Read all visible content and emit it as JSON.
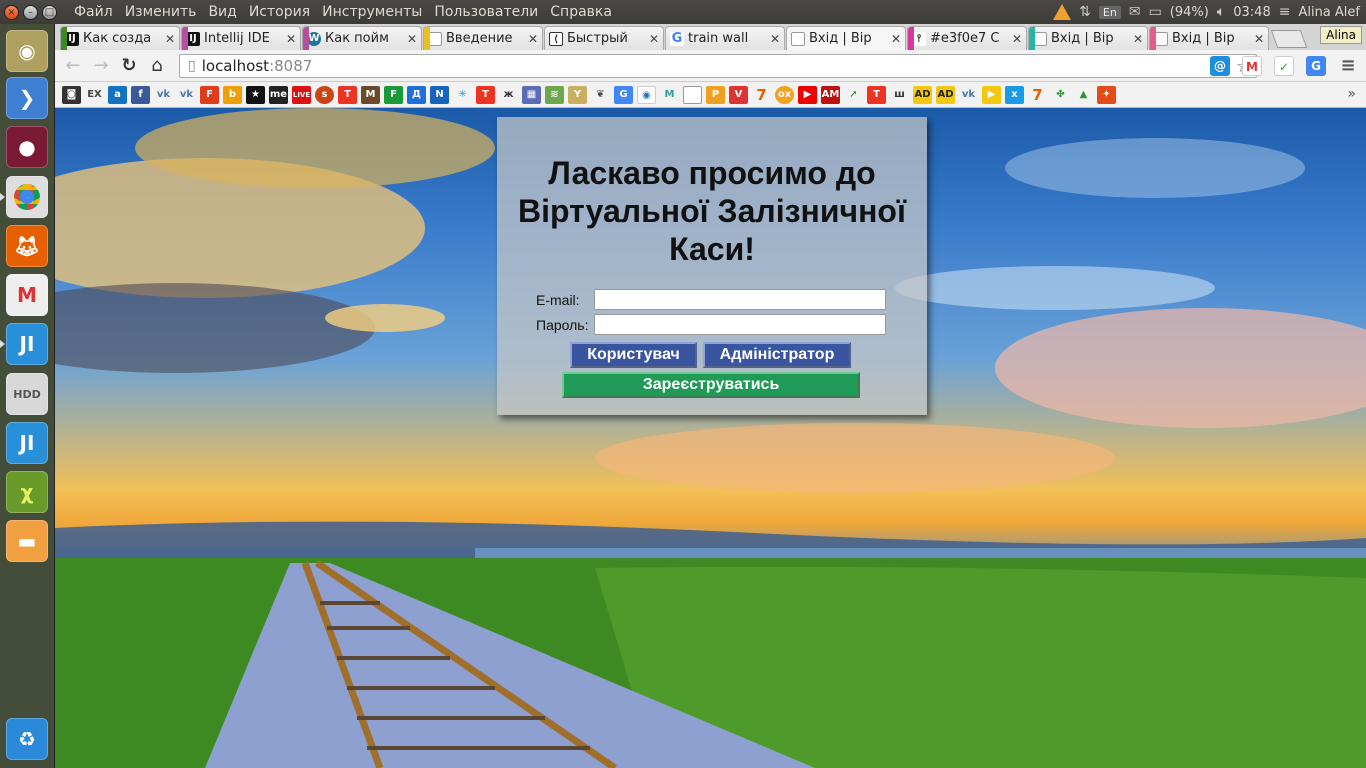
{
  "panel": {
    "menu": [
      "Файл",
      "Изменить",
      "Вид",
      "История",
      "Инструменты",
      "Пользователи",
      "Справка"
    ],
    "keyboard": "En",
    "battery": "(94%)",
    "time": "03:48",
    "user": "Alina Alef"
  },
  "tabs": [
    {
      "title": "Как созда",
      "accent": "#3d8b1e",
      "icon": "jetbrains-icon"
    },
    {
      "title": "Intellij IDE",
      "accent": "#b64fa0",
      "icon": "jetbrains-icon"
    },
    {
      "title": "Как пойм",
      "accent": "#b64fa0",
      "icon": "wordpress-icon"
    },
    {
      "title": "Введение",
      "accent": "#e8c020",
      "icon": "page-icon"
    },
    {
      "title": "Быстрый",
      "accent": "#d9d9d9",
      "icon": "hyperlink-icon"
    },
    {
      "title": "train wall",
      "accent": "#d9d9d9",
      "icon": "google-icon"
    },
    {
      "title": "Вхід | Вір",
      "accent": "#d9d9d9",
      "icon": "page-icon"
    },
    {
      "title": "#e3f0e7 C",
      "accent": "#d53aa0",
      "icon": "color-icon"
    },
    {
      "title": "Вхід | Вір",
      "accent": "#23b7a5",
      "icon": "page-icon"
    },
    {
      "title": "Вхід | Вір",
      "accent": "#e85a8a",
      "icon": "page-icon"
    }
  ],
  "profile_name": "Alina",
  "address": {
    "host": "localhost",
    "port": ":8087"
  },
  "login": {
    "title": "Ласкаво просимо до Віртуальної Залізничної Каси!",
    "email_label": "E-mail:",
    "email_value": "",
    "password_label": "Пароль:",
    "password_value": "",
    "user_button": "Користувач",
    "admin_button": "Адміністратор",
    "register_button": "Зареєструватись"
  }
}
